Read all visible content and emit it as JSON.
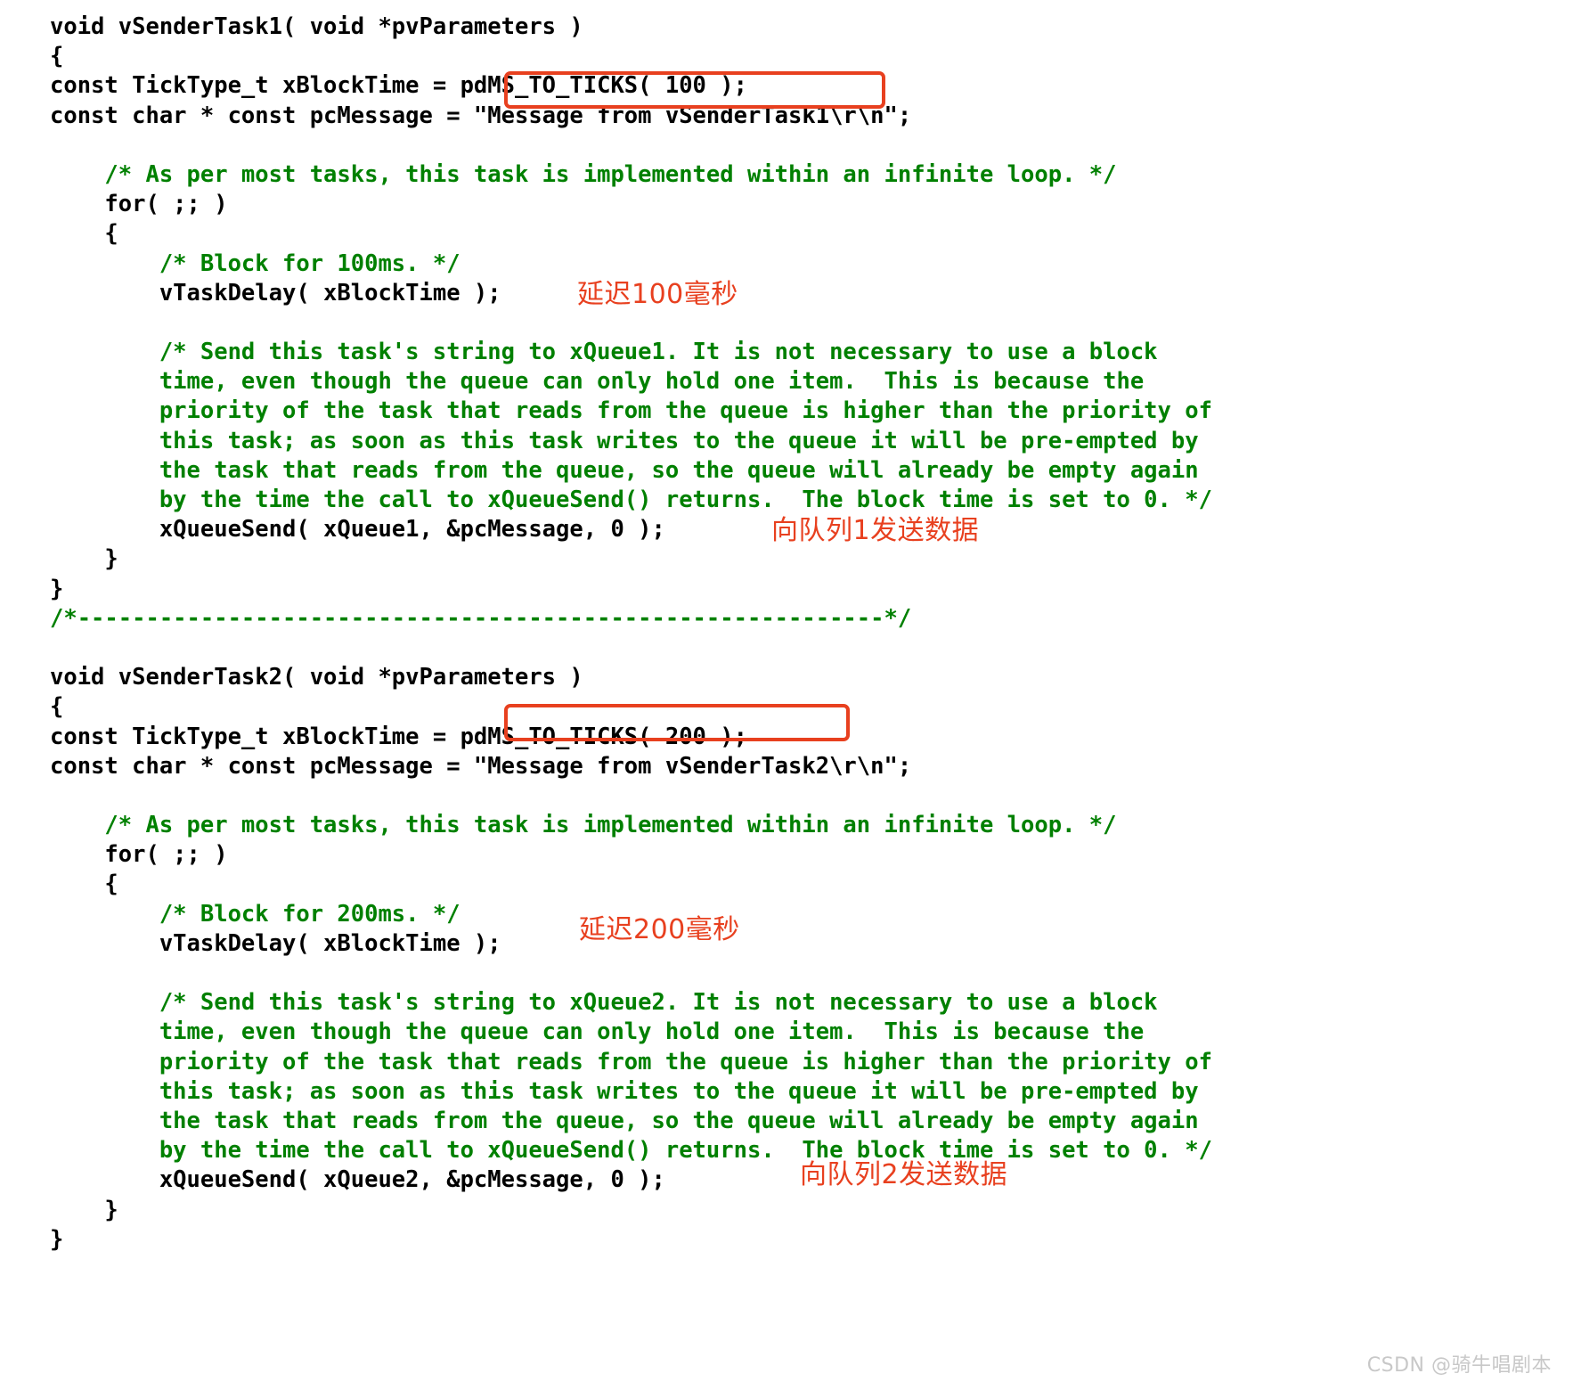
{
  "document": {
    "title": "FreeRTOS vSenderTask1 / vSenderTask2 code listing",
    "colors": {
      "code": "#000000",
      "comment": "#008000",
      "annotation": "#e8401f",
      "highlight_box": "#e8401f",
      "background": "#ffffff",
      "watermark": "#c8c8c8"
    },
    "lines": [
      {
        "kind": "code",
        "text": "void vSenderTask1( void *pvParameters )"
      },
      {
        "kind": "code",
        "text": "{"
      },
      {
        "kind": "code",
        "text": "const TickType_t xBlockTime = pdMS_TO_TICKS( 100 );"
      },
      {
        "kind": "code",
        "text": "const char * const pcMessage = \"Message from vSenderTask1\\r\\n\";"
      },
      {
        "kind": "blank",
        "text": ""
      },
      {
        "kind": "comment",
        "text": "    /* As per most tasks, this task is implemented within an infinite loop. */"
      },
      {
        "kind": "code",
        "text": "    for( ;; )"
      },
      {
        "kind": "code",
        "text": "    {"
      },
      {
        "kind": "comment",
        "text": "        /* Block for 100ms. */"
      },
      {
        "kind": "code",
        "text": "        vTaskDelay( xBlockTime );"
      },
      {
        "kind": "blank",
        "text": ""
      },
      {
        "kind": "comment",
        "text": "        /* Send this task's string to xQueue1. It is not necessary to use a block"
      },
      {
        "kind": "comment",
        "text": "        time, even though the queue can only hold one item.  This is because the"
      },
      {
        "kind": "comment",
        "text": "        priority of the task that reads from the queue is higher than the priority of"
      },
      {
        "kind": "comment",
        "text": "        this task; as soon as this task writes to the queue it will be pre-empted by"
      },
      {
        "kind": "comment",
        "text": "        the task that reads from the queue, so the queue will already be empty again"
      },
      {
        "kind": "comment",
        "text": "        by the time the call to xQueueSend() returns.  The block time is set to 0. */"
      },
      {
        "kind": "code",
        "text": "        xQueueSend( xQueue1, &pcMessage, 0 );"
      },
      {
        "kind": "code",
        "text": "    }"
      },
      {
        "kind": "code",
        "text": "}"
      },
      {
        "kind": "comment",
        "text": "/*-----------------------------------------------------------*/"
      },
      {
        "kind": "blank",
        "text": ""
      },
      {
        "kind": "code",
        "text": "void vSenderTask2( void *pvParameters )"
      },
      {
        "kind": "code",
        "text": "{"
      },
      {
        "kind": "code",
        "text": "const TickType_t xBlockTime = pdMS_TO_TICKS( 200 );"
      },
      {
        "kind": "code",
        "text": "const char * const pcMessage = \"Message from vSenderTask2\\r\\n\";"
      },
      {
        "kind": "blank",
        "text": ""
      },
      {
        "kind": "comment",
        "text": "    /* As per most tasks, this task is implemented within an infinite loop. */"
      },
      {
        "kind": "code",
        "text": "    for( ;; )"
      },
      {
        "kind": "code",
        "text": "    {"
      },
      {
        "kind": "comment",
        "text": "        /* Block for 200ms. */"
      },
      {
        "kind": "code",
        "text": "        vTaskDelay( xBlockTime );"
      },
      {
        "kind": "blank",
        "text": ""
      },
      {
        "kind": "comment",
        "text": "        /* Send this task's string to xQueue2. It is not necessary to use a block"
      },
      {
        "kind": "comment",
        "text": "        time, even though the queue can only hold one item.  This is because the"
      },
      {
        "kind": "comment",
        "text": "        priority of the task that reads from the queue is higher than the priority of"
      },
      {
        "kind": "comment",
        "text": "        this task; as soon as this task writes to the queue it will be pre-empted by"
      },
      {
        "kind": "comment",
        "text": "        the task that reads from the queue, so the queue will already be empty again"
      },
      {
        "kind": "comment",
        "text": "        by the time the call to xQueueSend() returns.  The block time is set to 0. */"
      },
      {
        "kind": "code",
        "text": "        xQueueSend( xQueue2, &pcMessage, 0 );"
      },
      {
        "kind": "code",
        "text": "    }"
      },
      {
        "kind": "code",
        "text": "}"
      }
    ],
    "highlights": [
      {
        "id": "hl-box-1",
        "target_text": "pdMS_TO_TICKS( 100 );"
      },
      {
        "id": "hl-box-2",
        "target_text": "pdMS_TO_TICKS( 200 );"
      }
    ],
    "annotations": [
      {
        "id": "cn-note-1",
        "text": "延迟100毫秒"
      },
      {
        "id": "cn-note-2",
        "text": "向队列1发送数据"
      },
      {
        "id": "cn-note-3",
        "text": "延迟200毫秒"
      },
      {
        "id": "cn-note-4",
        "text": "向队列2发送数据"
      }
    ],
    "watermark": "CSDN @骑牛唱剧本"
  }
}
